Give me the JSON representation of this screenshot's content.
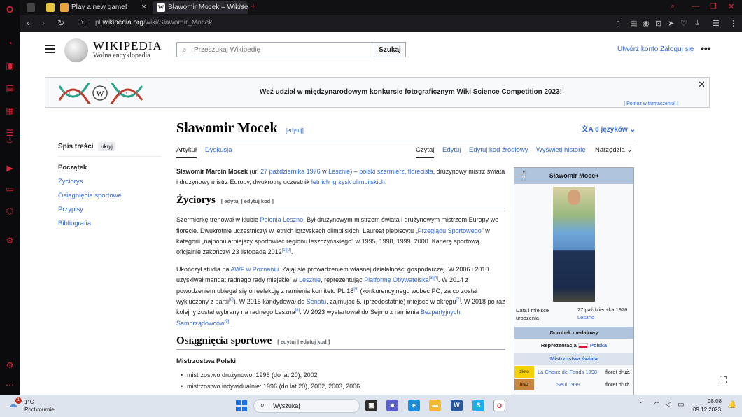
{
  "browser": {
    "tabs": [
      {
        "title": "Play a new game!",
        "favicon_color": "#e8a33d"
      },
      {
        "title": "Sławomir Mocek – Wikiped",
        "favicon_color": "#ffffff"
      }
    ],
    "url_prefix": "pl.",
    "url_domain": "wikipedia.org",
    "url_path": "/wiki/Sławomir_Mocek",
    "new_tab_symbol": "+"
  },
  "header": {
    "wordmark": "WIKIPEDIA",
    "tagline": "Wolna encyklopedia",
    "search_placeholder": "Przeszukaj Wikipedię",
    "search_button": "Szukaj",
    "create_account": "Utwórz konto",
    "login": "Zaloguj się"
  },
  "banner": {
    "text": "Weź udział w międzynarodowym konkursie fotograficznym Wiki Science Competition 2023!",
    "help": "[ Pomóż w tłumaczeniu! ]",
    "logo_letter": "W"
  },
  "toc": {
    "title": "Spis treści",
    "hide": "ukryj",
    "items": [
      "Początek",
      "Życiorys",
      "Osiągnięcia sportowe",
      "Przypisy",
      "Bibliografia"
    ]
  },
  "article": {
    "title": "Sławomir Mocek",
    "title_edit": "[edytuj]",
    "languages": "6 języków",
    "tab_article": "Artykuł",
    "tab_talk": "Dyskusja",
    "tab_read": "Czytaj",
    "tab_edit": "Edytuj",
    "tab_edit_source": "Edytuj kod źródłowy",
    "tab_history": "Wyświetl historię",
    "tab_tools": "Narzędzia",
    "lead": {
      "name_bold": "Sławomir Marcin Mocek",
      "t1": " (ur. ",
      "birth_date": "27 października 1976",
      "t2": " w ",
      "birth_place": "Lesznie",
      "t3": ") – ",
      "link_fencer": "polski szermierz",
      "t4": ", ",
      "link_foil": "florecista",
      "t5": ", drużynowy mistrz świata i drużynowy mistrz Europy, dwukrotny uczestnik ",
      "link_olympics": "letnich igrzysk olimpijskich",
      "t6": "."
    },
    "section_bio": "Życiorys",
    "section_edit_a": "[ edytuj | edytuj kod ]",
    "bio_p1": {
      "t1": "Szermierkę trenował w klubie ",
      "link_club": "Polonia Leszno",
      "t2": ". Był drużynowym mistrzem świata i drużynowym mistrzem Europy we florecie. Dwukrotnie uczestniczył w letnich igrzyskach olimpijskich. Laureat plebiscytu „",
      "link_przeglad": "Przeglądu Sportowego",
      "t3": "” w kategorii „najpopularniejszy sportowiec regionu leszczyńskiego” w 1995, 1998, 1999, 2000. Karierę sportową oficjalnie zakończył 23 listopada 2012",
      "ref1": "[1]",
      "ref2": "[2]",
      "t4": "."
    },
    "bio_p2": {
      "t1": "Ukończył studia na ",
      "link_awf": "AWF w Poznaniu",
      "t2": ". Zajął się prowadzeniem własnej działalności gospodarczej. W 2006 i 2010 uzyskiwał mandat radnego rady miejskiej w ",
      "link_leszno": "Lesznie",
      "t3": ", reprezentując ",
      "link_po": "Platformę Obywatelską",
      "ref3": "[3]",
      "ref4": "[4]",
      "t4": ". W 2014 z powodzeniem ubiegał się o reelekcję z ramienia komitetu PL 18",
      "ref5": "[5]",
      "t5": " (konkurencyjnego wobec PO, za co został wykluczony z partii",
      "ref6": "[6]",
      "t6": "). W 2015 kandydował do ",
      "link_senat": "Senatu",
      "t7": ", zajmując 5. (przedostatnie) miejsce w okręgu",
      "ref7": "[7]",
      "t8": ". W 2018 po raz kolejny został wybrany na radnego Leszna",
      "ref8": "[8]",
      "t9": ". W 2023 wystartował do Sejmu z ramienia ",
      "link_bs": "Bezpartyjnych Samorządowców",
      "ref9": "[9]",
      "t10": "."
    },
    "section_achievements": "Osiągnięcia sportowe",
    "section_edit_b": "[ edytuj | edytuj kod ]",
    "subsection_polish": "Mistrzostwa Polski",
    "medals": [
      "mistrzostwo drużynowo: 1996 (do lat 20), 2002",
      "mistrzostwo indywidualnie: 1996 (do lat 20), 2002, 2003, 2006"
    ]
  },
  "infobox": {
    "title": "Sławomir Mocek",
    "birth_label": "Data i miejsce urodzenia",
    "birth_date": "27 października 1976",
    "birth_place": "Leszno",
    "medals_band": "Dorobek medalowy",
    "representation_label": "Reprezentacja",
    "representation_value": "Polska",
    "world_band": "Mistrzostwa świata",
    "rows": [
      {
        "medal": "złoto",
        "color": "#f7d000",
        "event": "La Chaux-de-Fonds 1998",
        "type": "floret druż."
      },
      {
        "medal": "brąz",
        "color": "#c9853c",
        "event": "Seul 1999",
        "type": "floret druż."
      }
    ]
  },
  "taskbar": {
    "temp": "1°C",
    "weather": "Pochmurnie",
    "badge": "1",
    "search_label": "Wyszukaj",
    "time": "08:08",
    "date": "09.12.2023"
  }
}
